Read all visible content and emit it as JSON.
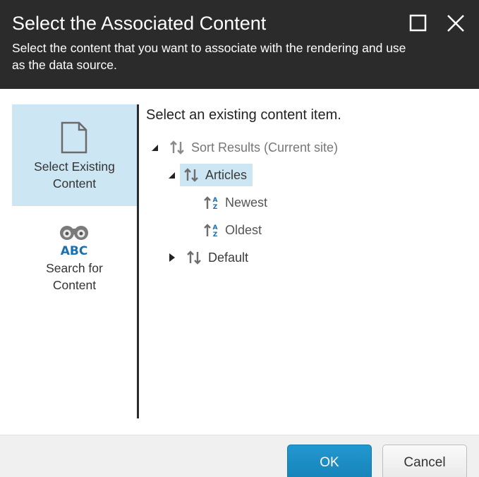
{
  "dialog": {
    "title": "Select the Associated Content",
    "subtitle": "Select the content that you want to associate with the rendering and use as the data source.",
    "header_bg": "#2b2b2b"
  },
  "window_controls": {
    "maximize_icon": "maximize-icon",
    "close_icon": "close-icon"
  },
  "nav": {
    "items": [
      {
        "label_line1": "Select Existing",
        "label_line2": "Content",
        "icon": "document-icon",
        "selected": true
      },
      {
        "label_line1": "Search for",
        "label_line2": "Content",
        "icon": "binoculars-abc-icon",
        "selected": false
      }
    ],
    "selected_bg": "#cce6f4"
  },
  "content": {
    "heading": "Select an existing content item.",
    "tree": [
      {
        "label": "Sort Results (Current site)",
        "icon": "sort-icon",
        "expanded": true,
        "level": 0
      },
      {
        "label": "Articles",
        "icon": "sort-icon",
        "expanded": true,
        "selected": true,
        "level": 1
      },
      {
        "label": "Newest",
        "icon": "sort-az-icon",
        "level": 2
      },
      {
        "label": "Oldest",
        "icon": "sort-az-icon",
        "level": 2
      },
      {
        "label": "Default",
        "icon": "sort-icon",
        "expanded": false,
        "level": 1
      }
    ]
  },
  "footer": {
    "ok_label": "OK",
    "cancel_label": "Cancel",
    "accent": "#1a8fc7"
  }
}
